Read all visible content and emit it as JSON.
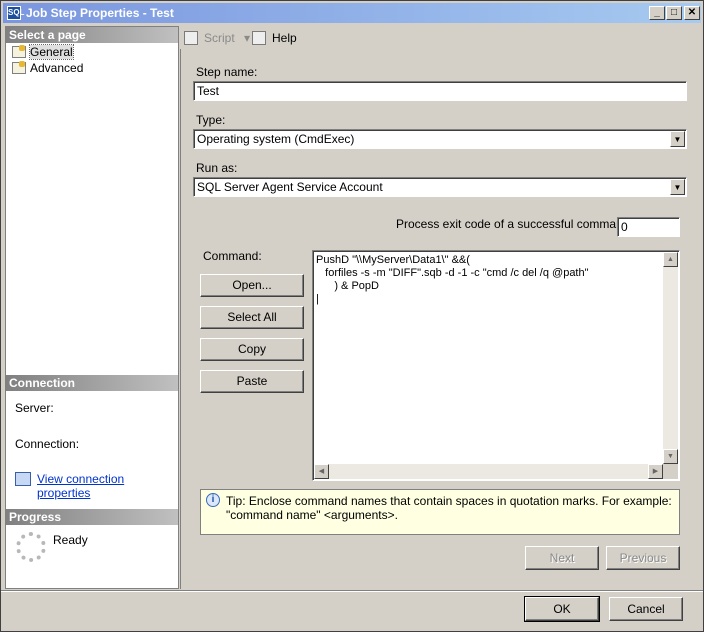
{
  "window": {
    "title": "Job Step Properties - Test",
    "minimize_glyph": "_",
    "maximize_glyph": "□",
    "close_glyph": "✕"
  },
  "left_panel": {
    "select_page_header": "Select a page",
    "pages": [
      {
        "label": "General",
        "selected": true
      },
      {
        "label": "Advanced",
        "selected": false
      }
    ],
    "connection_header": "Connection",
    "server_label": "Server:",
    "connection_label": "Connection:",
    "view_connection_link": "View connection properties",
    "progress_header": "Progress",
    "progress_status": "Ready"
  },
  "toolbar": {
    "script_label": "Script",
    "script_dropdown_glyph": "▾",
    "help_label": "Help"
  },
  "form": {
    "step_name_label": "Step name:",
    "step_name_value": "Test",
    "type_label": "Type:",
    "type_value": "Operating system (CmdExec)",
    "run_as_label": "Run as:",
    "run_as_value": "SQL Server Agent Service Account",
    "exit_code_label": "Process exit code of a successful command:",
    "exit_code_value": "0",
    "command_label": "Command:",
    "command_text": "PushD \"\\\\MyServer\\Data1\\\" &&(\n   forfiles -s -m \"DIFF\".sqb -d -1 -c \"cmd /c del /q @path\"\n      ) & PopD\n|",
    "open_button": "Open...",
    "select_all_button": "Select All",
    "copy_button": "Copy",
    "paste_button": "Paste",
    "tip_text": "Tip: Enclose command names that contain spaces in quotation marks. For example: \"command name\" <arguments>.",
    "next_button": "Next",
    "previous_button": "Previous"
  },
  "footer": {
    "ok_button": "OK",
    "cancel_button": "Cancel"
  }
}
